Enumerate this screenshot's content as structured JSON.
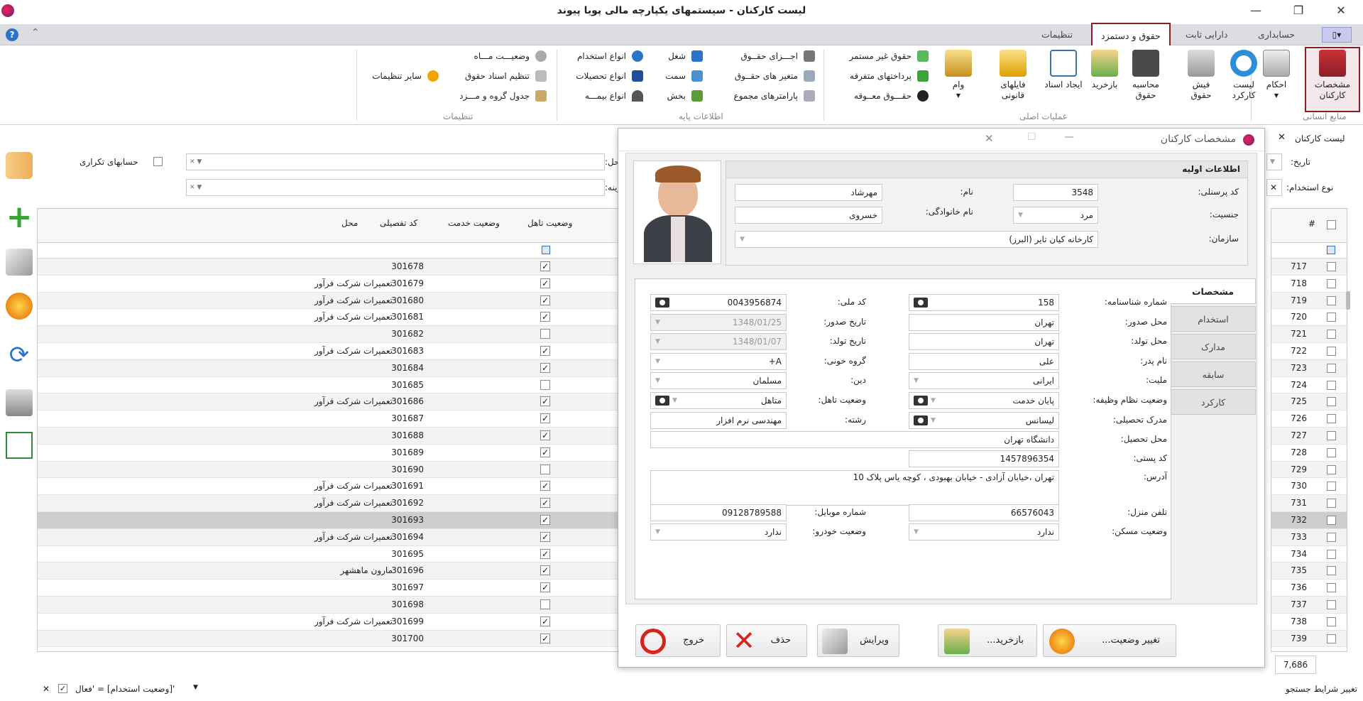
{
  "window": {
    "title": "لیست کارکنان - سیستمهای یکپارچه مالی پویا پیوند",
    "minimize": "—",
    "restore": "❐",
    "close": "✕"
  },
  "ribbon_tabs": [
    {
      "label": "حسابداری"
    },
    {
      "label": "دارایی ثابت"
    },
    {
      "label": "حقوق و دستمزد"
    },
    {
      "label": "تنظیمات"
    }
  ],
  "ribbon": {
    "groups": {
      "hr": "منابع انسانی",
      "main_ops": "عملیات اصلی",
      "base_info": "اطلاعات پایه",
      "settings": "تنظیمات"
    },
    "big_buttons": {
      "employee_specs": "مشخصات کارکنان",
      "decrees": "احکام",
      "work_list": "لیست کارکرد",
      "payslip": "فیش حقوق",
      "calc_salary": "محاسبه حقوق",
      "retirement": "بازخرید",
      "create_docs": "ایجاد اسناد",
      "legal_files": "فایلهای قانونی",
      "loan": "وام"
    },
    "small_buttons": {
      "non_continuous": "حقوق غیر مستمر",
      "misc_payments": "پرداختهای متفرقه",
      "deferred_salary": "حقـــوق معــوقه",
      "salary_parts": "اجـــزای حقــوق",
      "salary_vars": "متغیر های حقــوق",
      "collective_params": "پارامترهای مجموع",
      "job": "شغل",
      "position": "سمت",
      "section": "بخش",
      "employment_types": "انواع استخدام",
      "education_types": "انواع تحصیلات",
      "insurance_types": "انواع بیمـــه",
      "month_status": "وضعیـــت مـــاه",
      "doc_settings": "تنظیم اسناد حقوق",
      "wage_table": "جدول گروه و مـــزد",
      "other_settings": "سایر تنظیمات"
    }
  },
  "filters": {
    "date_label": "تاریخ:",
    "employment_type_label": "نوع استخدام:",
    "place_label_partial": "حل:",
    "cost_label_partial": "زینه:",
    "duplicate_accounts": "حسابهای تکراری"
  },
  "list_panel": {
    "title": "لیست کارکنان",
    "col_number": "#",
    "count": "7,686",
    "filter_text": "'[وضعیت استخدام] = 'فعال",
    "change_search": "تغییر شرایط جستجو"
  },
  "grid": {
    "headers": {
      "marital": "وضعیت تاهل",
      "service": "وضعیت خدمت",
      "detail_code": "کد تفصیلی",
      "place": "محل"
    },
    "rows": [
      {
        "n": "717",
        "code": "301678",
        "married": true,
        "place": ""
      },
      {
        "n": "718",
        "code": "301679",
        "married": true,
        "place": "تعمیرات شرکت فرآور"
      },
      {
        "n": "719",
        "code": "301680",
        "married": true,
        "place": "تعمیرات شرکت فرآور"
      },
      {
        "n": "720",
        "code": "301681",
        "married": true,
        "place": "تعمیرات شرکت فرآور"
      },
      {
        "n": "721",
        "code": "301682",
        "married": false,
        "place": ""
      },
      {
        "n": "722",
        "code": "301683",
        "married": true,
        "place": "تعمیرات شرکت فرآور"
      },
      {
        "n": "723",
        "code": "301684",
        "married": true,
        "place": ""
      },
      {
        "n": "724",
        "code": "301685",
        "married": false,
        "place": ""
      },
      {
        "n": "725",
        "code": "301686",
        "married": true,
        "place": "تعمیرات شرکت فرآور"
      },
      {
        "n": "726",
        "code": "301687",
        "married": true,
        "place": ""
      },
      {
        "n": "727",
        "code": "301688",
        "married": true,
        "place": ""
      },
      {
        "n": "728",
        "code": "301689",
        "married": true,
        "place": ""
      },
      {
        "n": "729",
        "code": "301690",
        "married": false,
        "place": ""
      },
      {
        "n": "730",
        "code": "301691",
        "married": true,
        "place": "تعمیرات شرکت فرآور"
      },
      {
        "n": "731",
        "code": "301692",
        "married": true,
        "place": "تعمیرات شرکت فرآور"
      },
      {
        "n": "732",
        "code": "301693",
        "married": true,
        "place": ""
      },
      {
        "n": "733",
        "code": "301694",
        "married": true,
        "place": "تعمیرات شرکت فرآور"
      },
      {
        "n": "734",
        "code": "301695",
        "married": true,
        "place": ""
      },
      {
        "n": "735",
        "code": "301696",
        "married": true,
        "place": "مارون ماهشهر"
      },
      {
        "n": "736",
        "code": "301697",
        "married": true,
        "place": ""
      },
      {
        "n": "737",
        "code": "301698",
        "married": false,
        "place": ""
      },
      {
        "n": "738",
        "code": "301699",
        "married": true,
        "place": "تعمیرات شرکت فرآور"
      },
      {
        "n": "739",
        "code": "301700",
        "married": true,
        "place": ""
      }
    ]
  },
  "dialog": {
    "title": "مشخصات کارکنان",
    "basic_info": "اطلاعات اولیه",
    "fields": {
      "personnel_code_label": "کد پرسنلی:",
      "personnel_code": "3548",
      "name_label": "نام:",
      "name": "مهرشاد",
      "gender_label": "جنسیت:",
      "gender": "مرد",
      "family_label": "نام خانوادگی:",
      "family": "خسروی",
      "org_label": "سازمان:",
      "org": "کارخانه کیان تایر (البرز)",
      "id_number_label": "شماره شناسنامه:",
      "id_number": "158",
      "national_code_label": "کد ملی:",
      "national_code": "0043956874",
      "issue_place_label": "محل صدور:",
      "issue_place": "تهران",
      "issue_date_label": "تاریخ صدور:",
      "issue_date": "1348/01/25",
      "birth_place_label": "محل تولد:",
      "birth_place": "تهران",
      "birth_date_label": "تاریخ تولد:",
      "birth_date": "1348/01/07",
      "father_label": "نام پدر:",
      "father": "علی",
      "blood_label": "گروه خونی:",
      "blood": "A+",
      "nationality_label": "ملیت:",
      "nationality": "ایرانی",
      "religion_label": "دین:",
      "religion": "مسلمان",
      "military_label": "وضعیت نظام وظیفه:",
      "military": "پایان خدمت",
      "marital_label": "وضعیت تاهل:",
      "marital": "متاهل",
      "degree_label": "مدرک تحصیلی:",
      "degree": "لیسانس",
      "field_label": "رشته:",
      "field": "مهندسی نرم افزار",
      "edu_place_label": "محل تحصیل:",
      "edu_place": "دانشگاه تهران",
      "postal_label": "کد پستی:",
      "postal": "1457896354",
      "address_label": "آدرس:",
      "address": "تهران ،خیابان آزادی - خیابان بهبودی ، کوچه یاس پلاک 10",
      "home_phone_label": "تلفن منزل:",
      "home_phone": "66576043",
      "mobile_label": "شماره موبایل:",
      "mobile": "09128789588",
      "housing_label": "وضعیت مسکن:",
      "housing": "ندارد",
      "car_label": "وضعیت خودرو:",
      "car": "ندارد"
    },
    "tabs": [
      "مشخصات",
      "استخدام",
      "مدارک",
      "سابقه",
      "کارکرد"
    ],
    "buttons": {
      "change_status": "تغییر وضعیت...",
      "retire": "بازخرید...",
      "edit": "ویرایش",
      "delete": "حذف",
      "exit": "خروج"
    }
  },
  "colors": {
    "accent": "#8b1c2a",
    "ribbon_bg": "#dcdde1"
  }
}
